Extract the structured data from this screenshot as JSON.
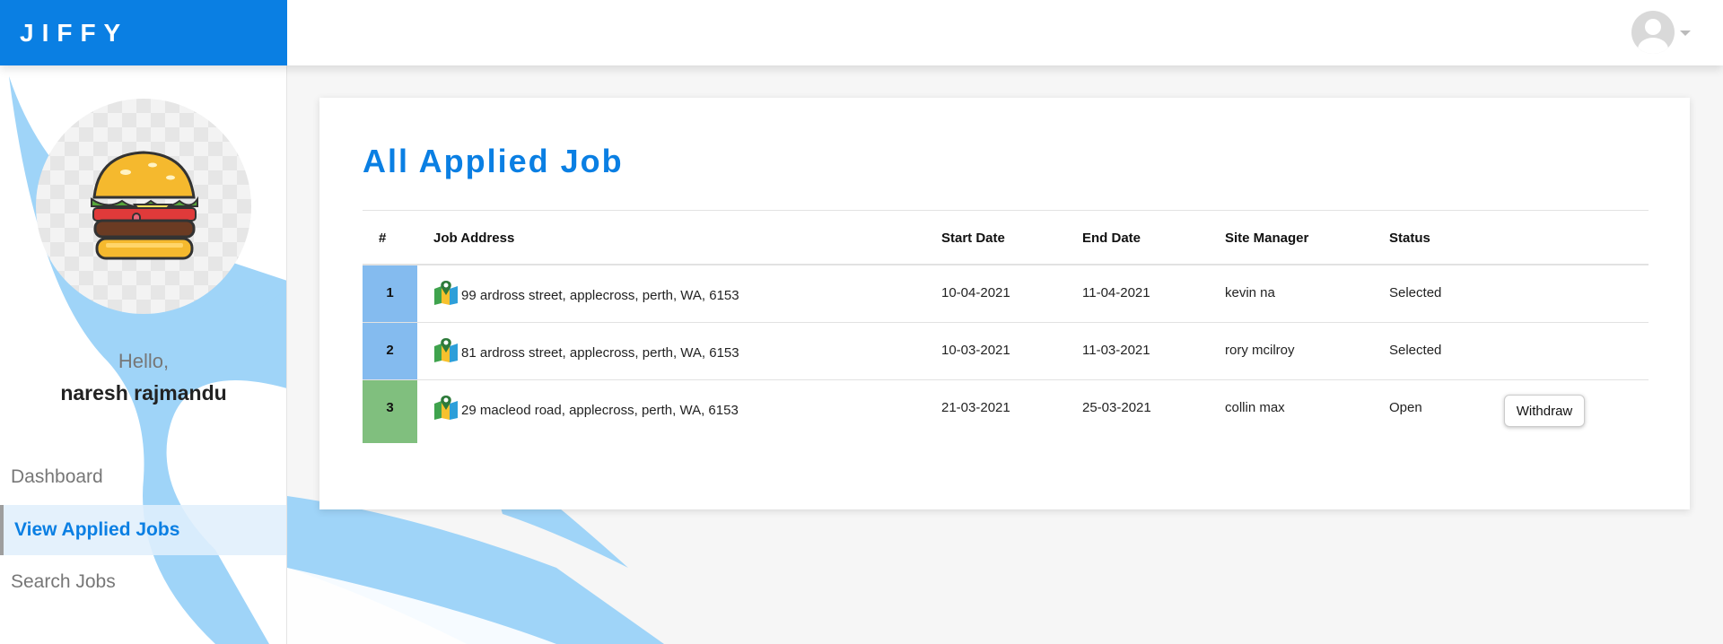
{
  "app": {
    "brand": "JIFFY"
  },
  "sidebar": {
    "greeting": "Hello,",
    "username": "naresh rajmandu",
    "nav": [
      {
        "label": "Dashboard",
        "active": false
      },
      {
        "label": "View Applied Jobs",
        "active": true
      },
      {
        "label": "Search Jobs",
        "active": false
      }
    ]
  },
  "main": {
    "title": "All Applied Job",
    "table": {
      "headers": [
        "#",
        "Job Address",
        "Start Date",
        "End Date",
        "Site Manager",
        "Status"
      ],
      "rows": [
        {
          "index": "1",
          "address": "99 ardross street, applecross, perth, WA, 6153",
          "start": "10-04-2021",
          "end": "11-04-2021",
          "manager": "kevin na",
          "status": "Selected"
        },
        {
          "index": "2",
          "address": "81 ardross street, applecross, perth, WA, 6153",
          "start": "10-03-2021",
          "end": "11-03-2021",
          "manager": "rory mcilroy",
          "status": "Selected"
        },
        {
          "index": "3",
          "address": "29 macleod road, applecross, perth, WA, 6153",
          "start": "21-03-2021",
          "end": "25-03-2021",
          "manager": "collin max",
          "status": "Open",
          "action": "Withdraw"
        }
      ]
    }
  },
  "colors": {
    "accent": "#0a7fe3",
    "row_selected": "#84bbef",
    "row_open": "#80bf7e",
    "decor": "#9fd4f8"
  },
  "icons": {
    "user": "user-avatar-icon",
    "dropdown": "chevron-down-icon",
    "map": "map-pin-icon",
    "profile": "burger-image"
  }
}
